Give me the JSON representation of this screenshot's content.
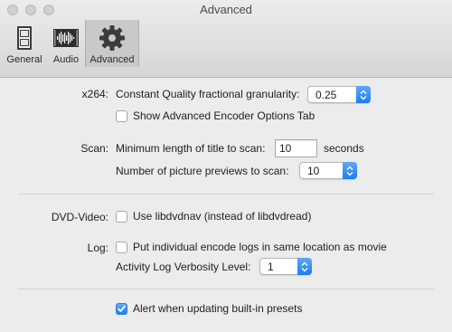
{
  "window": {
    "title": "Advanced"
  },
  "toolbar": {
    "items": [
      {
        "label": "General",
        "icon": "general-icon"
      },
      {
        "label": "Audio",
        "icon": "audio-waveform-icon"
      },
      {
        "label": "Advanced",
        "icon": "gear-icon",
        "selected": true
      }
    ]
  },
  "x264": {
    "section_label": "x264:",
    "granularity_label": "Constant Quality fractional granularity:",
    "granularity_value": "0.25",
    "show_advanced_tab_label": "Show Advanced Encoder Options Tab",
    "show_advanced_tab_checked": false
  },
  "scan": {
    "section_label": "Scan:",
    "min_length_label": "Minimum length of title to scan:",
    "min_length_value": "10",
    "min_length_unit": "seconds",
    "previews_label": "Number of picture previews to scan:",
    "previews_value": "10"
  },
  "dvd": {
    "section_label": "DVD-Video:",
    "libdvdnav_label": "Use libdvdnav (instead of libdvdread)",
    "libdvdnav_checked": false
  },
  "log": {
    "section_label": "Log:",
    "encode_logs_label": "Put individual encode logs in same location as movie",
    "encode_logs_checked": false,
    "verbosity_label": "Activity Log Verbosity Level:",
    "verbosity_value": "1"
  },
  "presets": {
    "alert_label": "Alert when updating built-in presets",
    "alert_checked": true
  },
  "colors": {
    "accent": "#1a7cf3",
    "window_bg": "#ececec",
    "selected_tab_bg": "#c9c9c9"
  }
}
